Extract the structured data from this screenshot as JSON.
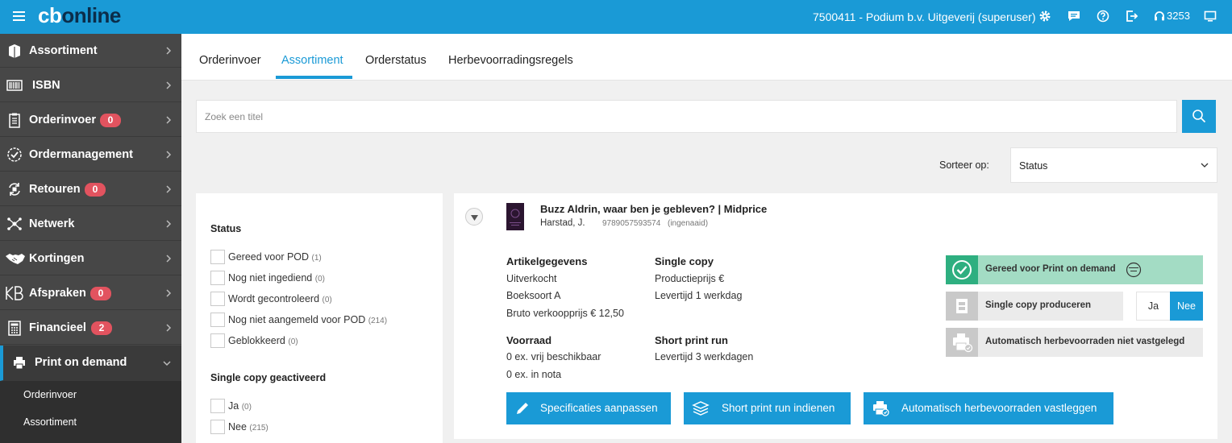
{
  "header": {
    "logo_cb": "cb",
    "logo_online": "online",
    "user": "7500411 - Podium b.v. Uitgeverij (superuser)",
    "phone": "3253"
  },
  "sidebar": {
    "items": [
      {
        "label": "Assortiment",
        "icon": "book-icon"
      },
      {
        "label": "ISBN",
        "icon": "barcode-icon"
      },
      {
        "label": "Orderinvoer",
        "icon": "clipboard-icon",
        "badge": "0"
      },
      {
        "label": "Ordermanagement",
        "icon": "check-circle-icon"
      },
      {
        "label": "Retouren",
        "icon": "return-icon",
        "badge": "0"
      },
      {
        "label": "Netwerk",
        "icon": "network-icon"
      },
      {
        "label": "Kortingen",
        "icon": "handshake-icon"
      },
      {
        "label": "Afspraken",
        "icon": "kb-icon",
        "badge": "0"
      },
      {
        "label": "Financieel",
        "icon": "calculator-icon",
        "badge": "2"
      },
      {
        "label": "Print on demand",
        "icon": "print-icon"
      }
    ],
    "sub_items": [
      {
        "label": "Orderinvoer"
      },
      {
        "label": "Assortiment"
      }
    ]
  },
  "tabs": [
    {
      "label": "Orderinvoer"
    },
    {
      "label": "Assortiment"
    },
    {
      "label": "Orderstatus"
    },
    {
      "label": "Herbevoorradingsregels"
    }
  ],
  "search": {
    "placeholder": "Zoek een titel"
  },
  "sort": {
    "label": "Sorteer op:",
    "value": "Status"
  },
  "filters": {
    "status_heading": "Status",
    "status_options": [
      {
        "label": "Gereed voor POD",
        "count": "(1)"
      },
      {
        "label": "Nog niet ingediend",
        "count": "(0)"
      },
      {
        "label": "Wordt gecontroleerd",
        "count": "(0)"
      },
      {
        "label": "Nog niet aangemeld voor POD",
        "count": "(214)"
      },
      {
        "label": "Geblokkeerd",
        "count": "(0)"
      }
    ],
    "single_heading": "Single copy geactiveerd",
    "single_options": [
      {
        "label": "Ja",
        "count": "(0)"
      },
      {
        "label": "Nee",
        "count": "(215)"
      }
    ]
  },
  "product": {
    "title": "Buzz Aldrin, waar ben je gebleven? | Midprice",
    "author": "Harstad, J.",
    "isbn": "9789057593574",
    "binding": "(ingenaaid)",
    "artikel_heading": "Artikelgegevens",
    "artikel_lines": [
      "Uitverkocht",
      "Boeksoort A",
      "Bruto verkoopprijs € 12,50"
    ],
    "single_heading": "Single copy",
    "single_lines": [
      "Productieprijs €",
      "Levertijd 1 werkdag"
    ],
    "voorraad_heading": "Voorraad",
    "voorraad_lines": [
      "0 ex. vrij beschikbaar",
      "0 ex. in nota"
    ],
    "short_heading": "Short print run",
    "short_lines": [
      "Levertijd 3 werkdagen"
    ],
    "status_pod": "Gereed voor Print on demand",
    "status_single": "Single copy produceren",
    "status_auto": "Automatisch herbevoorraden niet vastgelegd",
    "toggle_yes": "Ja",
    "toggle_no": "Nee",
    "btn_specs": "Specificaties aanpassen",
    "btn_short": "Short print run indienen",
    "btn_auto": "Automatisch herbevoorraden vastleggen"
  },
  "colors": {
    "accent": "#1a9ad6",
    "sidebar": "#474747",
    "badge": "#e2535f",
    "success": "#2eaf80"
  }
}
